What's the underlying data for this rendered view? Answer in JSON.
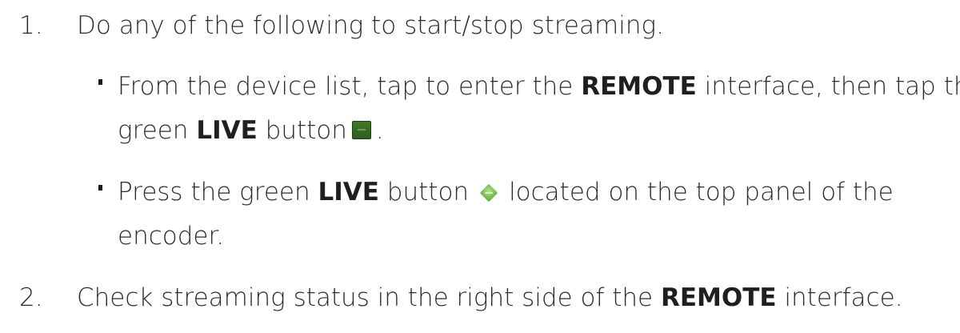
{
  "steps": [
    {
      "number": "1.",
      "text": "Do any of the following to start/stop streaming."
    },
    {
      "number": "2.",
      "text_before": "Check streaming status in the right side of the ",
      "bold": "REMOTE",
      "text_after": " interface."
    }
  ],
  "bullets": [
    {
      "line1_before": "From the device list, tap to enter the ",
      "line1_bold": "REMOTE",
      "line1_after": " interface, then tap the",
      "line2_before": "green ",
      "line2_bold": "LIVE",
      "line2_after": " button",
      "line2_end": ".",
      "icon": "live-button-square-icon"
    },
    {
      "line1_before": "Press the green ",
      "line1_bold": "LIVE",
      "line1_mid": " button",
      "line1_after": "located on the top panel of the",
      "line2": "encoder.",
      "icon": "live-button-diamond-icon"
    }
  ],
  "colors": {
    "text": "#2b2b2b",
    "live_square": "#2d5e1d",
    "live_diamond": "#7cc05a"
  }
}
